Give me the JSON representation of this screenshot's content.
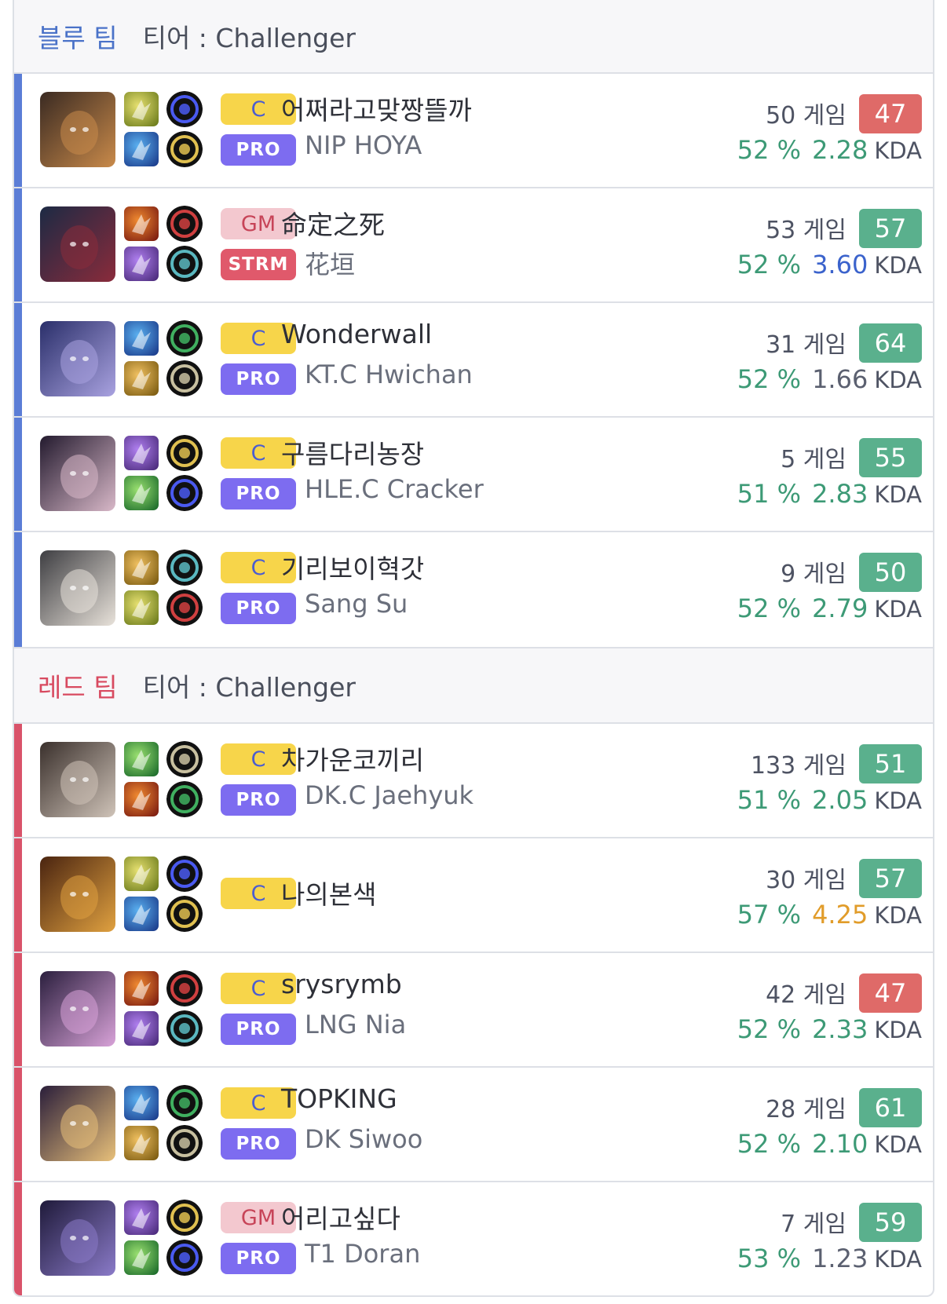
{
  "blue_team": {
    "name": "블루 팀",
    "tier": "티어 : Challenger",
    "players": [
      {
        "tier": "C",
        "name": "어쩌라고맞짱뜰까",
        "pro_tag": "PRO",
        "pro_name": "NIP HOYA",
        "games": "50 게임",
        "score": "47",
        "score_level": "lo",
        "winrate": "52 %",
        "kda": "2.28",
        "kda_color": "green",
        "kda_label": "KDA"
      },
      {
        "tier": "GM",
        "name": "命定之死",
        "pro_tag": "STRM",
        "pro_name": "花垣",
        "games": "53 게임",
        "score": "57",
        "score_level": "hi",
        "winrate": "52 %",
        "kda": "3.60",
        "kda_color": "blue",
        "kda_label": "KDA"
      },
      {
        "tier": "C",
        "name": "Wonderwall",
        "pro_tag": "PRO",
        "pro_name": "KT.C Hwichan",
        "games": "31 게임",
        "score": "64",
        "score_level": "hi",
        "winrate": "52 %",
        "kda": "1.66",
        "kda_color": "gray",
        "kda_label": "KDA"
      },
      {
        "tier": "C",
        "name": "구름다리농장",
        "pro_tag": "PRO",
        "pro_name": "HLE.C Cracker",
        "games": "5 게임",
        "score": "55",
        "score_level": "hi",
        "winrate": "51 %",
        "kda": "2.83",
        "kda_color": "green",
        "kda_label": "KDA"
      },
      {
        "tier": "C",
        "name": "기리보이혁갓",
        "pro_tag": "PRO",
        "pro_name": "Sang Su",
        "games": "9 게임",
        "score": "50",
        "score_level": "hi",
        "winrate": "52 %",
        "kda": "2.79",
        "kda_color": "green",
        "kda_label": "KDA"
      }
    ]
  },
  "red_team": {
    "name": "레드 팀",
    "tier": "티어 : Challenger",
    "players": [
      {
        "tier": "C",
        "name": "차가운코끼리",
        "pro_tag": "PRO",
        "pro_name": "DK.C Jaehyuk",
        "games": "133 게임",
        "score": "51",
        "score_level": "hi",
        "winrate": "51 %",
        "kda": "2.05",
        "kda_color": "green",
        "kda_label": "KDA"
      },
      {
        "tier": "C",
        "name": "나의본색",
        "pro_tag": "",
        "pro_name": "",
        "games": "30 게임",
        "score": "57",
        "score_level": "hi",
        "winrate": "57 %",
        "kda": "4.25",
        "kda_color": "orange",
        "kda_label": "KDA"
      },
      {
        "tier": "C",
        "name": "srysrymb",
        "pro_tag": "PRO",
        "pro_name": "LNG Nia",
        "games": "42 게임",
        "score": "47",
        "score_level": "lo",
        "winrate": "52 %",
        "kda": "2.33",
        "kda_color": "green",
        "kda_label": "KDA"
      },
      {
        "tier": "C",
        "name": "TOPKING",
        "pro_tag": "PRO",
        "pro_name": "DK Siwoo",
        "games": "28 게임",
        "score": "61",
        "score_level": "hi",
        "winrate": "52 %",
        "kda": "2.10",
        "kda_color": "green",
        "kda_label": "KDA"
      },
      {
        "tier": "GM",
        "name": "어리고싶다",
        "pro_tag": "PRO",
        "pro_name": "T1 Doran",
        "games": "7 게임",
        "score": "59",
        "score_level": "hi",
        "winrate": "53 %",
        "kda": "1.23",
        "kda_color": "gray",
        "kda_label": "KDA"
      }
    ]
  },
  "colors": {
    "blue_team": "#5b7dd6",
    "red_team": "#d9536a",
    "score_high": "#5ab08d",
    "score_low": "#df6a68",
    "tier_c_bg": "#f7d54a",
    "tier_gm_bg": "#f3c8cf",
    "pro_badge": "#7d6cf0",
    "strm_badge": "#e0596b"
  },
  "icons": {
    "spells": [
      "flash-spell-icon",
      "ignite-spell-icon",
      "teleport-spell-icon",
      "smite-spell-icon",
      "ghost-spell-icon",
      "exhaust-spell-icon",
      "heal-spell-icon",
      "barrier-spell-icon"
    ],
    "runes": [
      "keystone-rune-icon",
      "secondary-rune-icon"
    ]
  }
}
